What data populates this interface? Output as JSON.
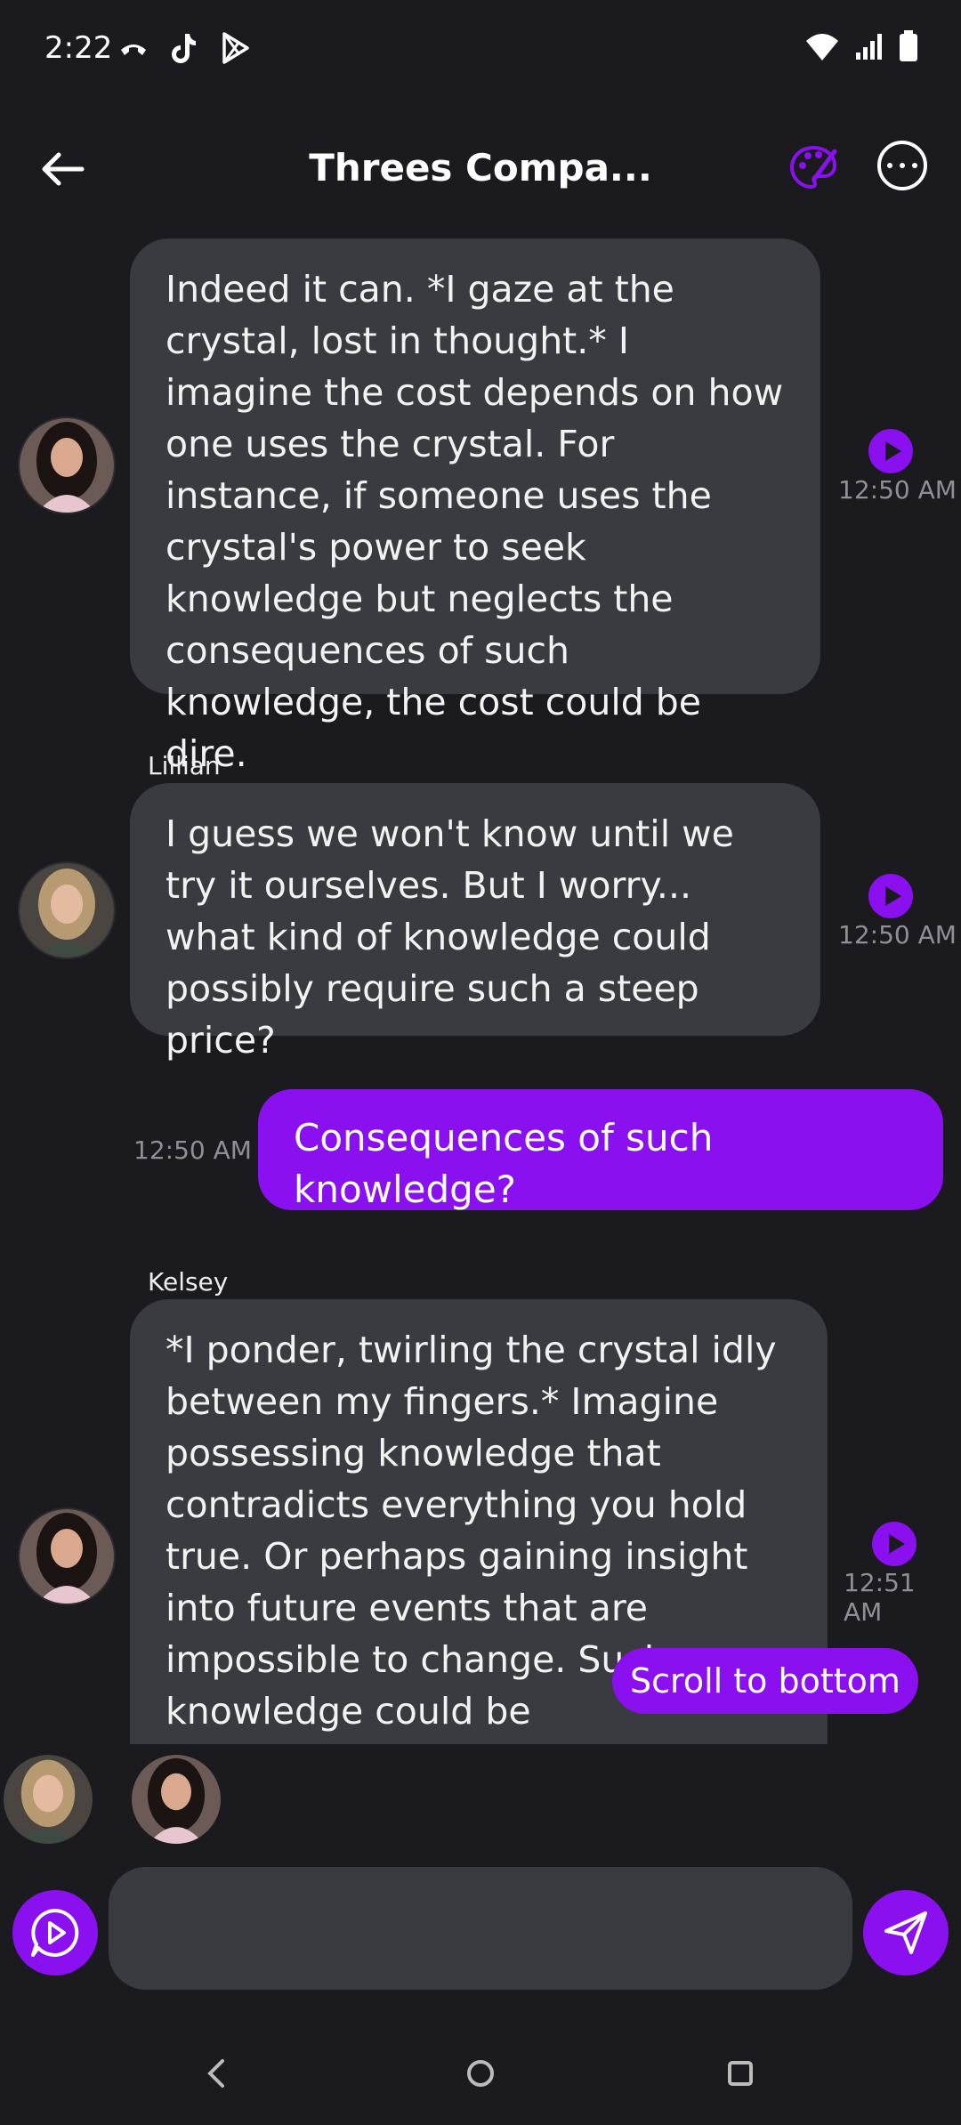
{
  "status_bar": {
    "time": "2:22"
  },
  "app_bar": {
    "title": "Threes Compa..."
  },
  "messages": [
    {
      "sender": "",
      "text": "Indeed it can. *I gaze at the crystal, lost in thought.* I imagine the cost depends on how one uses the crystal. For instance, if someone uses the crystal's power to seek knowledge but neglects the consequences of such knowledge, the cost could be dire.",
      "time": "12:50 AM"
    },
    {
      "sender": "Lillian",
      "text": "I guess we won't know until we try it ourselves. But I worry... what kind of knowledge could possibly require such a steep price?",
      "time": "12:50 AM"
    },
    {
      "sender": "",
      "text": "Consequences of such knowledge?",
      "time": "12:50 AM",
      "from_user": true
    },
    {
      "sender": "Kelsey",
      "text": "*I ponder, twirling the crystal idly between my fingers.* Imagine possessing knowledge that contradicts everything you hold true. Or perhaps gaining insight into future events that are impossible to change. Such knowledge could be overwhelming,",
      "time": "12:51 AM"
    }
  ],
  "scroll_button": "Scroll to bottom",
  "composer": {
    "placeholder": ""
  },
  "colors": {
    "accent": "#8a10f0",
    "bubble": "#3a3b41",
    "background": "#1a1a1f"
  }
}
